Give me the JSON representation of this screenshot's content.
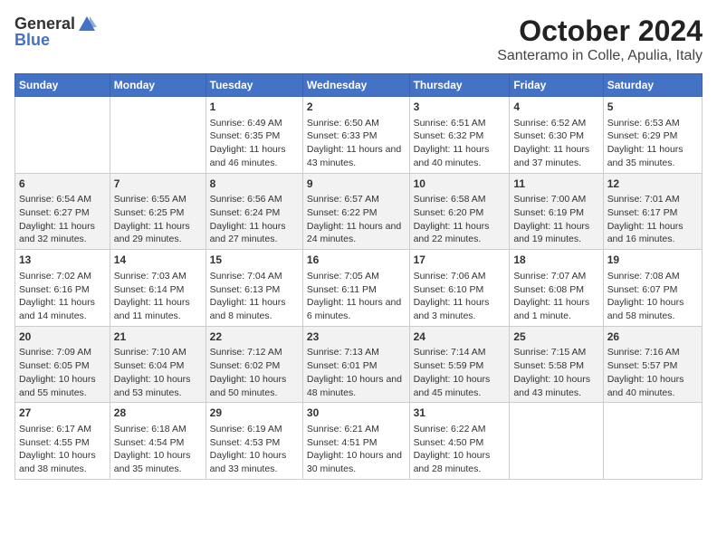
{
  "logo": {
    "general": "General",
    "blue": "Blue"
  },
  "title": "October 2024",
  "subtitle": "Santeramo in Colle, Apulia, Italy",
  "days_of_week": [
    "Sunday",
    "Monday",
    "Tuesday",
    "Wednesday",
    "Thursday",
    "Friday",
    "Saturday"
  ],
  "weeks": [
    [
      {
        "day": "",
        "content": ""
      },
      {
        "day": "",
        "content": ""
      },
      {
        "day": "1",
        "content": "Sunrise: 6:49 AM\nSunset: 6:35 PM\nDaylight: 11 hours and 46 minutes."
      },
      {
        "day": "2",
        "content": "Sunrise: 6:50 AM\nSunset: 6:33 PM\nDaylight: 11 hours and 43 minutes."
      },
      {
        "day": "3",
        "content": "Sunrise: 6:51 AM\nSunset: 6:32 PM\nDaylight: 11 hours and 40 minutes."
      },
      {
        "day": "4",
        "content": "Sunrise: 6:52 AM\nSunset: 6:30 PM\nDaylight: 11 hours and 37 minutes."
      },
      {
        "day": "5",
        "content": "Sunrise: 6:53 AM\nSunset: 6:29 PM\nDaylight: 11 hours and 35 minutes."
      }
    ],
    [
      {
        "day": "6",
        "content": "Sunrise: 6:54 AM\nSunset: 6:27 PM\nDaylight: 11 hours and 32 minutes."
      },
      {
        "day": "7",
        "content": "Sunrise: 6:55 AM\nSunset: 6:25 PM\nDaylight: 11 hours and 29 minutes."
      },
      {
        "day": "8",
        "content": "Sunrise: 6:56 AM\nSunset: 6:24 PM\nDaylight: 11 hours and 27 minutes."
      },
      {
        "day": "9",
        "content": "Sunrise: 6:57 AM\nSunset: 6:22 PM\nDaylight: 11 hours and 24 minutes."
      },
      {
        "day": "10",
        "content": "Sunrise: 6:58 AM\nSunset: 6:20 PM\nDaylight: 11 hours and 22 minutes."
      },
      {
        "day": "11",
        "content": "Sunrise: 7:00 AM\nSunset: 6:19 PM\nDaylight: 11 hours and 19 minutes."
      },
      {
        "day": "12",
        "content": "Sunrise: 7:01 AM\nSunset: 6:17 PM\nDaylight: 11 hours and 16 minutes."
      }
    ],
    [
      {
        "day": "13",
        "content": "Sunrise: 7:02 AM\nSunset: 6:16 PM\nDaylight: 11 hours and 14 minutes."
      },
      {
        "day": "14",
        "content": "Sunrise: 7:03 AM\nSunset: 6:14 PM\nDaylight: 11 hours and 11 minutes."
      },
      {
        "day": "15",
        "content": "Sunrise: 7:04 AM\nSunset: 6:13 PM\nDaylight: 11 hours and 8 minutes."
      },
      {
        "day": "16",
        "content": "Sunrise: 7:05 AM\nSunset: 6:11 PM\nDaylight: 11 hours and 6 minutes."
      },
      {
        "day": "17",
        "content": "Sunrise: 7:06 AM\nSunset: 6:10 PM\nDaylight: 11 hours and 3 minutes."
      },
      {
        "day": "18",
        "content": "Sunrise: 7:07 AM\nSunset: 6:08 PM\nDaylight: 11 hours and 1 minute."
      },
      {
        "day": "19",
        "content": "Sunrise: 7:08 AM\nSunset: 6:07 PM\nDaylight: 10 hours and 58 minutes."
      }
    ],
    [
      {
        "day": "20",
        "content": "Sunrise: 7:09 AM\nSunset: 6:05 PM\nDaylight: 10 hours and 55 minutes."
      },
      {
        "day": "21",
        "content": "Sunrise: 7:10 AM\nSunset: 6:04 PM\nDaylight: 10 hours and 53 minutes."
      },
      {
        "day": "22",
        "content": "Sunrise: 7:12 AM\nSunset: 6:02 PM\nDaylight: 10 hours and 50 minutes."
      },
      {
        "day": "23",
        "content": "Sunrise: 7:13 AM\nSunset: 6:01 PM\nDaylight: 10 hours and 48 minutes."
      },
      {
        "day": "24",
        "content": "Sunrise: 7:14 AM\nSunset: 5:59 PM\nDaylight: 10 hours and 45 minutes."
      },
      {
        "day": "25",
        "content": "Sunrise: 7:15 AM\nSunset: 5:58 PM\nDaylight: 10 hours and 43 minutes."
      },
      {
        "day": "26",
        "content": "Sunrise: 7:16 AM\nSunset: 5:57 PM\nDaylight: 10 hours and 40 minutes."
      }
    ],
    [
      {
        "day": "27",
        "content": "Sunrise: 6:17 AM\nSunset: 4:55 PM\nDaylight: 10 hours and 38 minutes."
      },
      {
        "day": "28",
        "content": "Sunrise: 6:18 AM\nSunset: 4:54 PM\nDaylight: 10 hours and 35 minutes."
      },
      {
        "day": "29",
        "content": "Sunrise: 6:19 AM\nSunset: 4:53 PM\nDaylight: 10 hours and 33 minutes."
      },
      {
        "day": "30",
        "content": "Sunrise: 6:21 AM\nSunset: 4:51 PM\nDaylight: 10 hours and 30 minutes."
      },
      {
        "day": "31",
        "content": "Sunrise: 6:22 AM\nSunset: 4:50 PM\nDaylight: 10 hours and 28 minutes."
      },
      {
        "day": "",
        "content": ""
      },
      {
        "day": "",
        "content": ""
      }
    ]
  ]
}
